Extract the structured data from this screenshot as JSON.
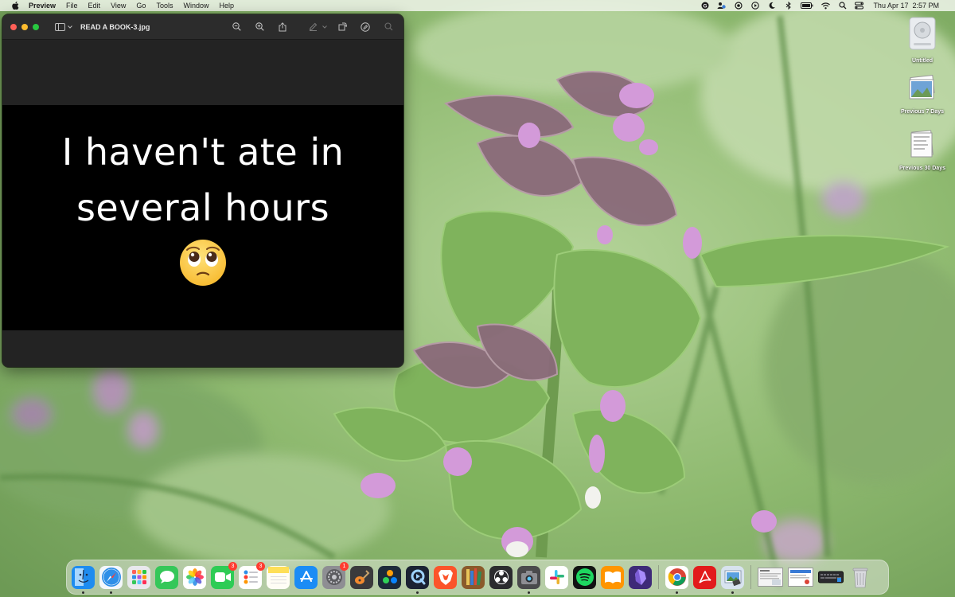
{
  "menubar": {
    "app_name": "Preview",
    "menus": [
      "File",
      "Edit",
      "View",
      "Go",
      "Tools",
      "Window",
      "Help"
    ],
    "status_icons": [
      "grammarly-icon",
      "user-sync-icon",
      "record-icon",
      "play-icon",
      "moon-icon",
      "bluetooth-icon",
      "battery-icon",
      "wifi-icon",
      "search-icon",
      "control-center-icon"
    ],
    "date": "Thu Apr 17",
    "time": "2:57 PM"
  },
  "desktop_icons": [
    {
      "name": "Untitled",
      "icon": "disk-icon"
    },
    {
      "name": "Previous 7 Days",
      "icon": "stack-photos-icon"
    },
    {
      "name": "Previous 30 Days",
      "icon": "stack-docs-icon"
    }
  ],
  "preview_window": {
    "title": "READ A BOOK-3.jpg",
    "toolbar": [
      "zoom-out-icon",
      "zoom-in-icon",
      "share-icon",
      "markup-icon",
      "rotate-icon",
      "annotate-icon",
      "search-icon"
    ],
    "image_text_line1": "I haven't ate in",
    "image_text_line2": "several hours",
    "image_emoji": "pleading-face-emoji"
  },
  "dock": {
    "apps": [
      {
        "name": "Finder",
        "icon": "finder-icon",
        "color": "#1e8cf0",
        "running": true
      },
      {
        "name": "Safari",
        "icon": "safari-icon",
        "color": "#2f8fe8",
        "running": true
      },
      {
        "name": "Launchpad",
        "icon": "launchpad-icon",
        "color": "#e9e9ee",
        "running": false
      },
      {
        "name": "Messages",
        "icon": "messages-icon",
        "color": "#35c759",
        "running": false
      },
      {
        "name": "Photos",
        "icon": "photos-icon",
        "color": "#ffffff",
        "running": false
      },
      {
        "name": "FaceTime",
        "icon": "facetime-icon",
        "color": "#2ecc55",
        "running": false,
        "badge": "3"
      },
      {
        "name": "Reminders",
        "icon": "reminders-icon",
        "color": "#ffffff",
        "running": false,
        "badge": "3"
      },
      {
        "name": "Notes",
        "icon": "notes-icon",
        "color": "#fedf57",
        "running": false
      },
      {
        "name": "App Store",
        "icon": "app-store-icon",
        "color": "#1b8cf5",
        "running": false
      },
      {
        "name": "System Settings",
        "icon": "settings-icon",
        "color": "#8e8e93",
        "running": false,
        "badge": "1"
      },
      {
        "name": "GarageBand",
        "icon": "garageband-icon",
        "color": "#3a3a3c",
        "running": false
      },
      {
        "name": "DaVinci Resolve",
        "icon": "davinci-icon",
        "color": "#1d2a3a",
        "running": false
      },
      {
        "name": "QuickTime Player",
        "icon": "quicktime-icon",
        "color": "#1b2233",
        "running": true
      },
      {
        "name": "Brave",
        "icon": "brave-icon",
        "color": "#fb542b",
        "running": false
      },
      {
        "name": "Calibre",
        "icon": "books-shelf-icon",
        "color": "#8a5a2b",
        "running": false
      },
      {
        "name": "OBS",
        "icon": "obs-icon",
        "color": "#2b2b2e",
        "running": false
      },
      {
        "name": "Screenshot",
        "icon": "camera-icon",
        "color": "#4a4a4c",
        "running": true
      },
      {
        "name": "Slack",
        "icon": "slack-icon",
        "color": "#ffffff",
        "running": false
      },
      {
        "name": "Spotify",
        "icon": "spotify-icon",
        "color": "#1ed760",
        "running": false
      },
      {
        "name": "Books",
        "icon": "books-icon",
        "color": "#ff9500",
        "running": false
      },
      {
        "name": "Obsidian",
        "icon": "obsidian-icon",
        "color": "#3e2a78",
        "running": false
      }
    ],
    "apps_after_separator": [
      {
        "name": "Chrome",
        "icon": "chrome-icon",
        "color": "#ffffff",
        "running": true
      },
      {
        "name": "Acrobat",
        "icon": "acrobat-icon",
        "color": "#e21b1b",
        "running": false
      },
      {
        "name": "Preview",
        "icon": "preview-icon",
        "color": "#d8e3ef",
        "running": true
      }
    ],
    "recent_windows": [
      {
        "name": "document-thumbnail-1",
        "icon": "window-thumbnail-icon"
      },
      {
        "name": "document-thumbnail-2",
        "icon": "window-thumbnail-icon"
      },
      {
        "name": "keyboard-thumbnail",
        "icon": "keyboard-icon"
      }
    ],
    "trash": {
      "name": "Trash",
      "icon": "trash-icon"
    }
  }
}
